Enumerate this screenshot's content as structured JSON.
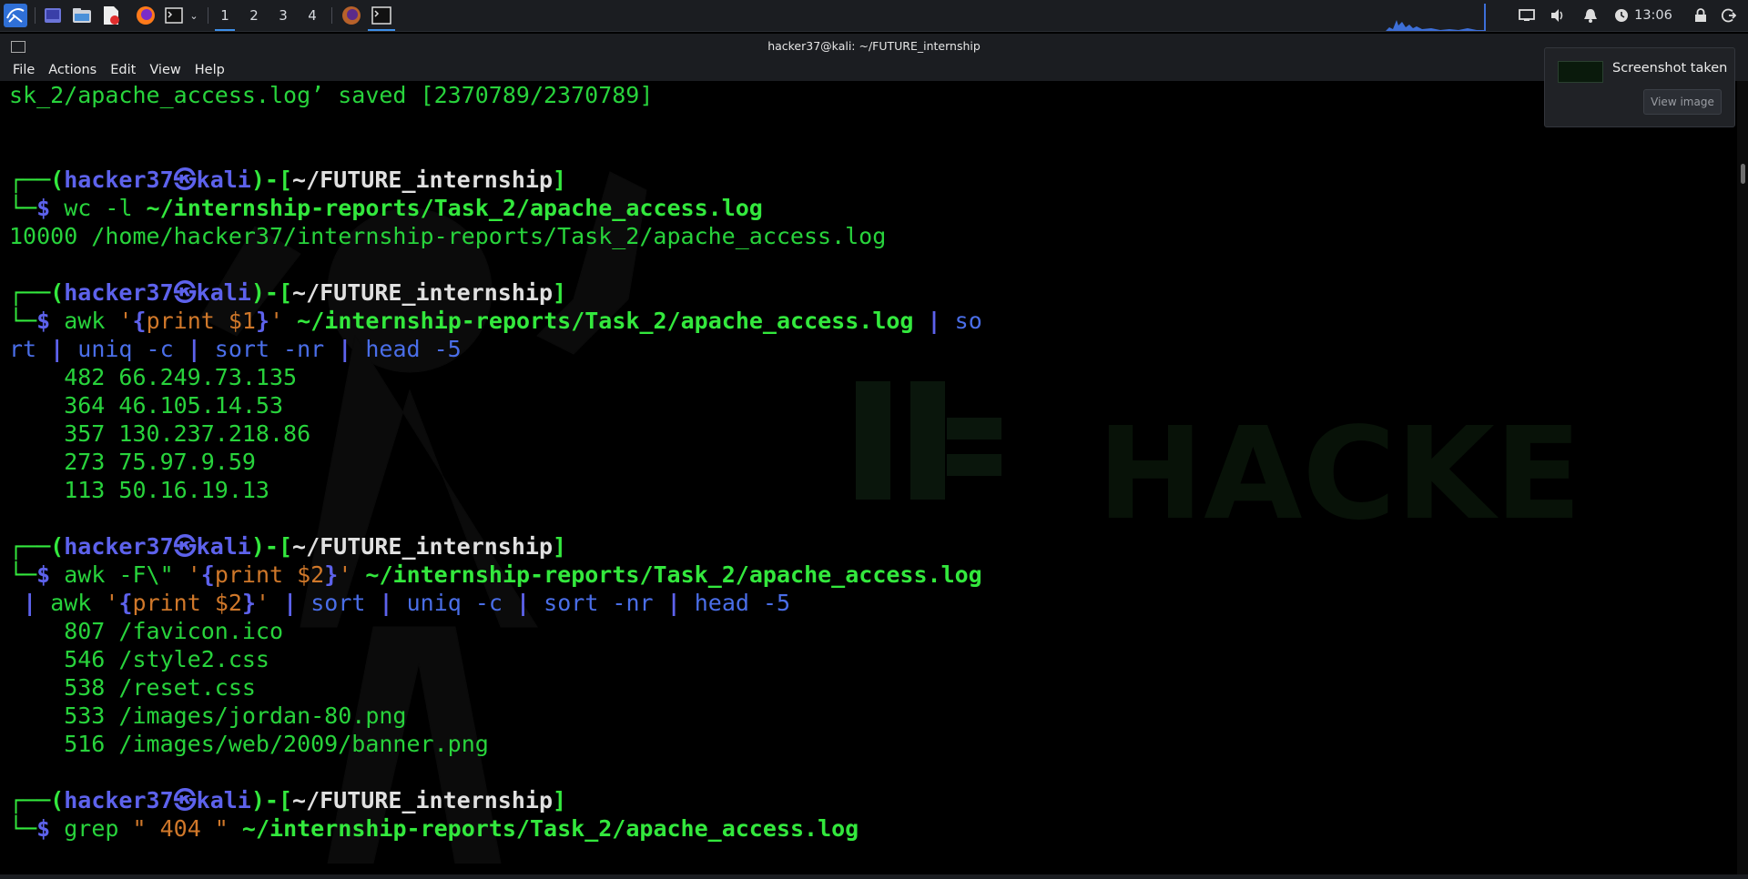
{
  "panel": {
    "workspaces": [
      "1",
      "2",
      "3",
      "4"
    ],
    "clock": "13:06"
  },
  "window": {
    "title": "hacker37@kali: ~/FUTURE_internship",
    "menu": [
      "File",
      "Actions",
      "Edit",
      "View",
      "Help"
    ]
  },
  "terminal": {
    "line0": "sk_2/apache_access.log’ saved [2370789/2370789]",
    "prompt": {
      "user": "hacker37",
      "sym": "㉿",
      "host": "kali",
      "cwd": "~/FUTURE_internship",
      "dollar": "$"
    },
    "cmd1": {
      "a": "wc -l ",
      "b": "~/internship-reports/Task_2/apache_access.log"
    },
    "out1": "10000 /home/hacker37/internship-reports/Task_2/apache_access.log",
    "cmd2": {
      "a": "awk ",
      "q1": "'",
      "lb": "{",
      "body": "print $1",
      "rb": "}",
      "q2": "'",
      "path": " ~/internship-reports/Task_2/apache_access.log ",
      "pipe": "|",
      "so": " so",
      "cont1": "rt ",
      "cont2": " uniq -c ",
      "cont3": " sort -nr ",
      "cont4": " head -5"
    },
    "out2": [
      "    482 66.249.73.135",
      "    364 46.105.14.53",
      "    357 130.237.218.86",
      "    273 75.97.9.59",
      "    113 50.16.19.13"
    ],
    "cmd3": {
      "a": "awk -F\\\" ",
      "q1": "'",
      "lb": "{",
      "body": "print $2",
      "rb": "}",
      "q2": "'",
      "path": " ~/internship-reports/Task_2/apache_access.log",
      "c1": "awk ",
      "c2": " sort ",
      "c3": " uniq -c ",
      "c4": " sort -nr ",
      "c5": " head -5"
    },
    "out3": [
      "    807 /favicon.ico",
      "    546 /style2.css",
      "    538 /reset.css",
      "    533 /images/jordan-80.png",
      "    516 /images/web/2009/banner.png"
    ],
    "cmd4": {
      "a": "grep ",
      "s": "\" 404 \"",
      "path": " ~/internship-reports/Task_2/apache_access.log"
    }
  },
  "notification": {
    "title": "Screenshot taken",
    "button": "View image"
  },
  "colors": {
    "green": "#28d33c",
    "blue": "#5d62ec",
    "orange": "#d0782a",
    "panel": "#1b1d21"
  }
}
